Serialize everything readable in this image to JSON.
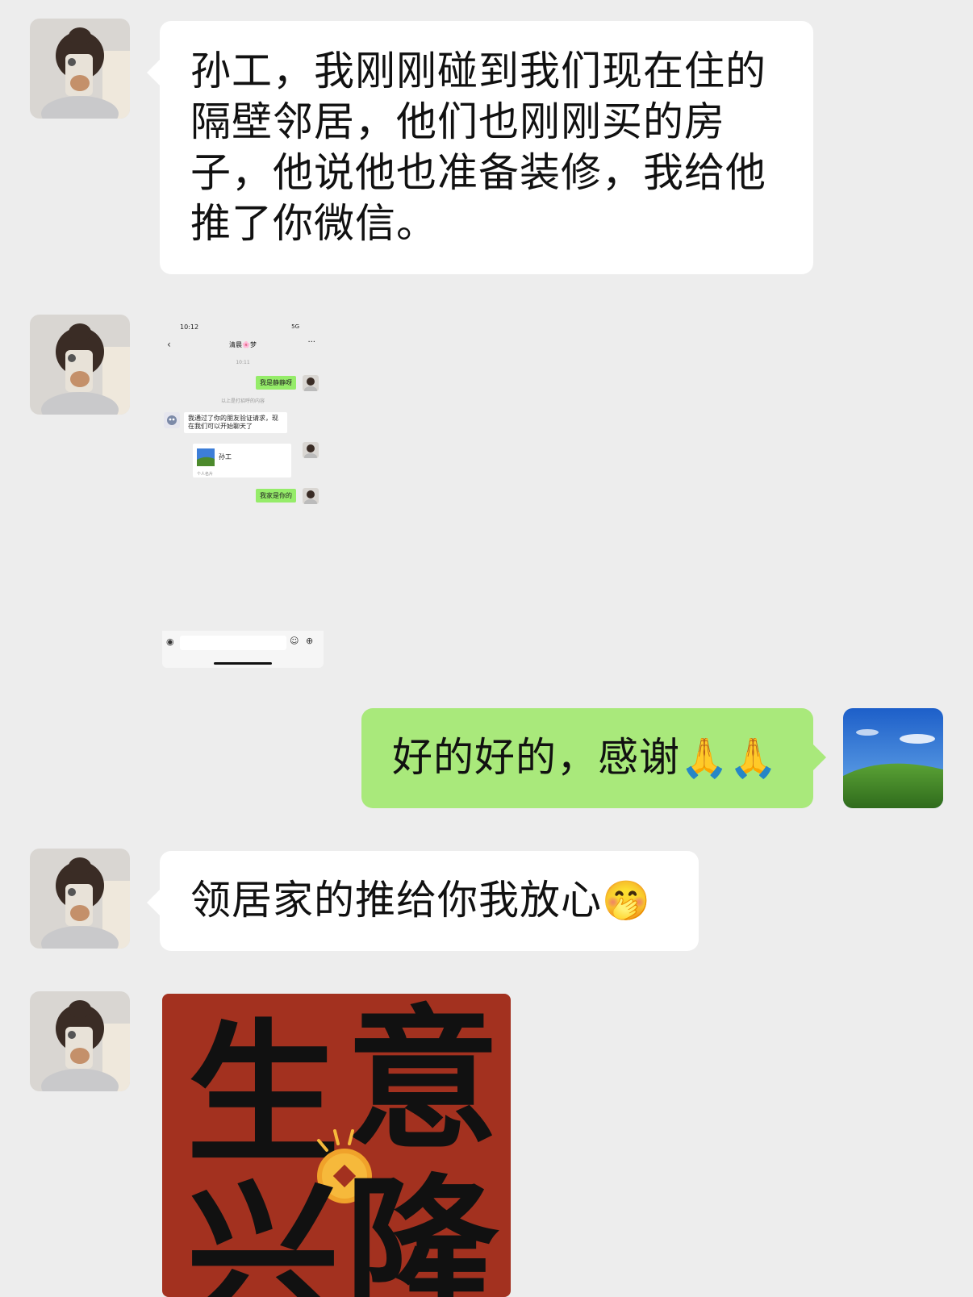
{
  "messages": {
    "m1": {
      "text": "孙工，我刚刚碰到我们现在住的隔壁邻居，他们也刚刚买的房子，他说他也准备装修，我给他推了你微信。"
    },
    "m3": {
      "text": "好的好的，感谢",
      "emoji": "🙏🙏"
    },
    "m4": {
      "text": "领居家的推给你我放心",
      "emoji": "🤭"
    }
  },
  "screenshot": {
    "time": "10:12",
    "signal": "5G",
    "title": "清晨🌸梦",
    "stamp1": "10:11",
    "msg1": "我是静静呀",
    "system": "以上是打招呼的内容",
    "msg2": "我通过了你的朋友验证请求，现在我们可以开始聊天了",
    "card_name": "孙工",
    "card_sub": "个人名片",
    "msg3": "我家是你的"
  },
  "sticker": {
    "chars": [
      "生",
      "意",
      "兴",
      "隆"
    ]
  },
  "colors": {
    "background": "#ededed",
    "incoming_bubble": "#ffffff",
    "outgoing_bubble": "#a9e97b",
    "sticker_red": "#a3311f"
  }
}
